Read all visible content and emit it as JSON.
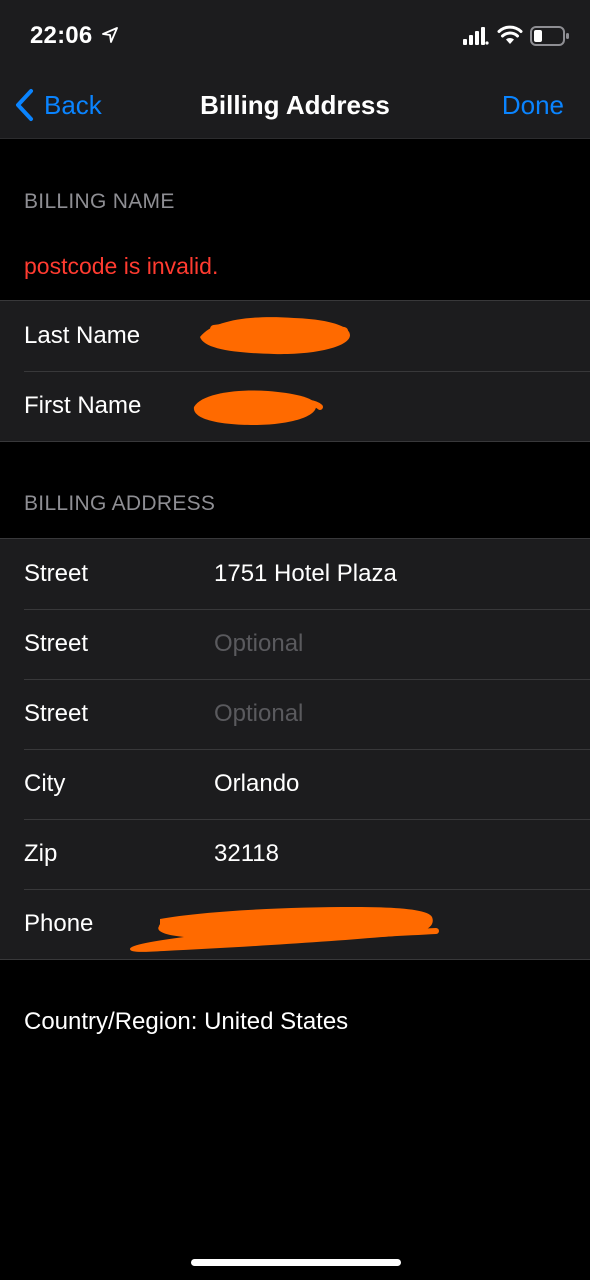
{
  "status_bar": {
    "time": "22:06",
    "icons": [
      "location-arrow-icon",
      "signal-icon",
      "wifi-icon",
      "battery-icon"
    ]
  },
  "nav": {
    "back_label": "Back",
    "title": "Billing Address",
    "done_label": "Done"
  },
  "billing_name": {
    "header": "BILLING NAME",
    "error": "postcode is invalid.",
    "rows": [
      {
        "label": "Last Name",
        "value": "",
        "redacted": true
      },
      {
        "label": "First Name",
        "value": "",
        "redacted": true
      }
    ]
  },
  "billing_address": {
    "header": "BILLING ADDRESS",
    "rows": [
      {
        "label": "Street",
        "value": "1751 Hotel Plaza",
        "placeholder": ""
      },
      {
        "label": "Street",
        "value": "",
        "placeholder": "Optional"
      },
      {
        "label": "Street",
        "value": "",
        "placeholder": "Optional"
      },
      {
        "label": "City",
        "value": "Orlando",
        "placeholder": ""
      },
      {
        "label": "Zip",
        "value": "32118",
        "placeholder": ""
      },
      {
        "label": "Phone",
        "value": "",
        "placeholder": "",
        "redacted": true
      }
    ]
  },
  "country_region": "Country/Region: United States",
  "colors": {
    "accent": "#0a84ff",
    "error": "#ff3b30",
    "redaction": "#ff6a00",
    "background": "#000000",
    "cell": "#1c1c1e"
  }
}
